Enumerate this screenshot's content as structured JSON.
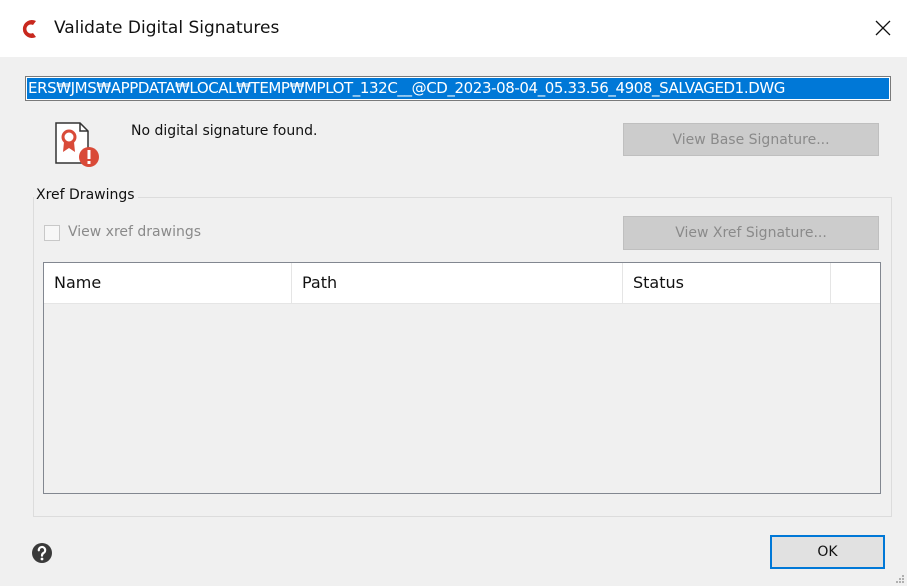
{
  "window": {
    "title": "Validate Digital Signatures"
  },
  "file_path": "ERS₩JMS₩APPDATA₩LOCAL₩TEMP₩MPLOT_132C__@CD_2023-08-04_05.33.56_4908_SALVAGED1.DWG",
  "signature": {
    "status_message": "No digital signature found.",
    "view_base_label": "View Base Signature..."
  },
  "xref": {
    "group_label": "Xref Drawings",
    "checkbox_label": "View xref drawings",
    "checkbox_checked": false,
    "view_xref_label": "View Xref Signature...",
    "columns": [
      "Name",
      "Path",
      "Status",
      ""
    ],
    "rows": []
  },
  "footer": {
    "ok_label": "OK"
  },
  "colors": {
    "accent": "#0078d7",
    "app_icon": "#c8281e",
    "warning": "#d94a38",
    "dialog_bg": "#f0f0f0"
  },
  "icons": {
    "app": "autocad-c-icon",
    "signature": "certificate-warning-icon",
    "help": "help-circle-icon",
    "close": "close-icon"
  }
}
